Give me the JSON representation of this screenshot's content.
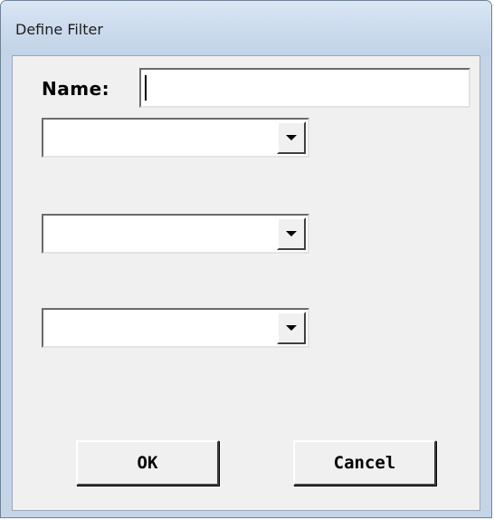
{
  "window": {
    "title": "Define Filter"
  },
  "form": {
    "name_label": "Name:",
    "name_value": "",
    "filters": [
      {
        "value": ""
      },
      {
        "value": ""
      },
      {
        "value": ""
      }
    ]
  },
  "buttons": {
    "ok_label": "OK",
    "cancel_label": "Cancel"
  },
  "icons": {
    "dropdown": "chevron-down-icon"
  },
  "colors": {
    "titlebar": "#cddcee",
    "client_bg": "#f0f0f0"
  }
}
